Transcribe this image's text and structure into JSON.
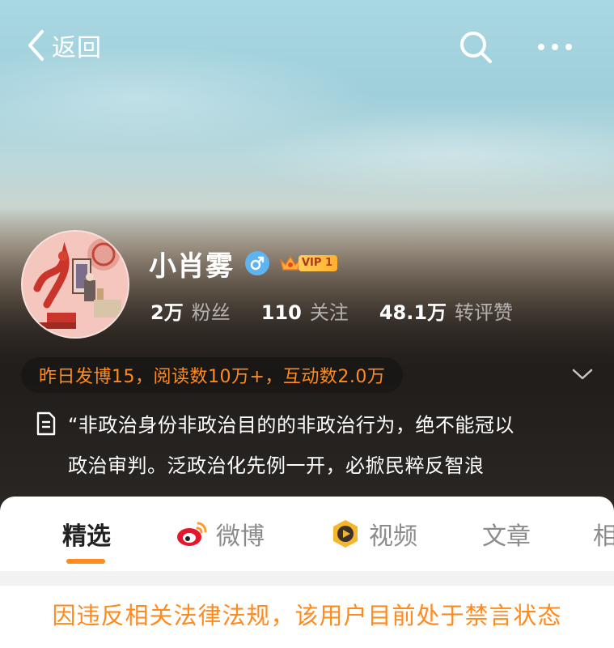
{
  "topbar": {
    "back_label": "返回",
    "icons": [
      "back-chevron-icon",
      "search-icon",
      "more-dots-icon"
    ]
  },
  "profile": {
    "name": "小肖雾",
    "gender": "male",
    "vip_label": "VIP 1",
    "stats": [
      {
        "value": "2万",
        "label": "粉丝"
      },
      {
        "value": "110",
        "label": "关注"
      },
      {
        "value": "48.1万",
        "label": "转评赞"
      }
    ],
    "daily_summary": "昨日发博15，阅读数10万+，互动数2.0万",
    "bio_line1": "“非政治身份非政治目的的非政治行为，绝不能冠以",
    "bio_line2": "政治审判。泛政治化先例一开，必掀民粹反智浪"
  },
  "tabs": [
    {
      "label": "精选",
      "active": true
    },
    {
      "label": "微博",
      "icon": "weibo-icon"
    },
    {
      "label": "视频",
      "icon": "video-icon"
    },
    {
      "label": "文章"
    },
    {
      "label": "相"
    }
  ],
  "notice": "因违反相关法律法规，该用户目前处于禁言状态",
  "colors": {
    "accent": "#ff8a1e",
    "gender_badge": "#5fb4f0",
    "vip_gold": "#ffb02e"
  }
}
